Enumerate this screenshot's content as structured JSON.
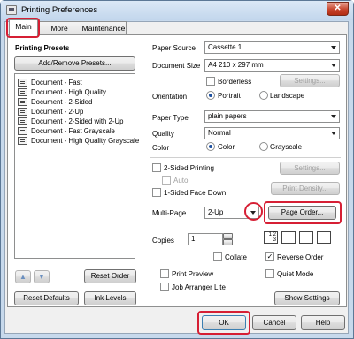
{
  "window": {
    "title": "Printing Preferences",
    "close_glyph": "✕"
  },
  "tabs": [
    {
      "label": "Main"
    },
    {
      "label": "More Options"
    },
    {
      "label": "Maintenance"
    }
  ],
  "presets": {
    "heading": "Printing Presets",
    "add_remove": "Add/Remove Presets...",
    "items": [
      "Document - Fast",
      "Document - High Quality",
      "Document - 2-Sided",
      "Document - 2-Up",
      "Document - 2-Sided with 2-Up",
      "Document - Fast Grayscale",
      "Document - High Quality Grayscale"
    ],
    "up_glyph": "▲",
    "down_glyph": "▼",
    "reset_order": "Reset Order"
  },
  "settings": {
    "paper_source": {
      "label": "Paper Source",
      "value": "Cassette 1"
    },
    "document_size": {
      "label": "Document Size",
      "value": "A4 210 x 297 mm"
    },
    "borderless": {
      "label": "Borderless",
      "button": "Settings..."
    },
    "orientation": {
      "label": "Orientation",
      "portrait": "Portrait",
      "landscape": "Landscape"
    },
    "paper_type": {
      "label": "Paper Type",
      "value": "plain papers"
    },
    "quality": {
      "label": "Quality",
      "value": "Normal"
    },
    "color": {
      "label": "Color",
      "color": "Color",
      "grayscale": "Grayscale"
    },
    "two_sided": {
      "label": "2-Sided Printing",
      "auto": "Auto",
      "settings": "Settings...",
      "density": "Print Density..."
    },
    "one_sided_face_down": "1-Sided Face Down",
    "multi_page": {
      "label": "Multi-Page",
      "value": "2-Up",
      "page_order": "Page Order..."
    },
    "copies": {
      "label": "Copies",
      "value": "1",
      "collate": "Collate",
      "reverse_order": "Reverse Order"
    },
    "print_preview": "Print Preview",
    "quiet_mode": "Quiet Mode",
    "job_arranger": "Job Arranger Lite",
    "show_settings": "Show Settings"
  },
  "bottom": {
    "reset_defaults": "Reset Defaults",
    "ink_levels": "Ink Levels",
    "ok": "OK",
    "cancel": "Cancel",
    "help": "Help"
  },
  "colors": {
    "highlight": "#d61f34",
    "accent": "#1b4fa0"
  },
  "icons": {
    "check": "✓",
    "page_glyph": "1 2 3"
  }
}
